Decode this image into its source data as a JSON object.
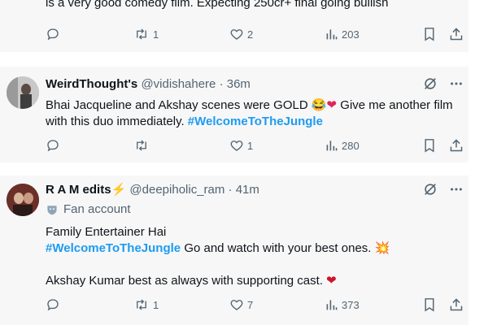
{
  "tweets": [
    {
      "text": "is a very good comedy film. Expecting 250cr+ final going bullish",
      "stats": {
        "replies": "",
        "retweets": "1",
        "likes": "2",
        "views": "203"
      }
    },
    {
      "name": "WeirdThought's",
      "handle": "@vidishahere",
      "dot": "·",
      "time": "36m",
      "text_part1": "Bhai Jacqueline and Akshay scenes were GOLD ",
      "emoji": "😂❤",
      "text_part2": " Give me another film with this duo immediately. ",
      "hashtag": "#WelcomeToTheJungle",
      "stats": {
        "replies": "",
        "retweets": "",
        "likes": "1",
        "views": "280"
      }
    },
    {
      "name": "R A M edits",
      "badge_emoji": "⚡",
      "handle": "@deepiholic_ram",
      "dot": "·",
      "time": "41m",
      "fan_label": "Fan account",
      "line1": "Family Entertainer Hai",
      "hashtag": "#WelcomeToTheJungle",
      "line2_rest": " Go and watch with your best ones. ",
      "line2_emoji": "💥",
      "line3": "Akshay Kumar best as always with supporting cast. ",
      "line3_emoji": "❤",
      "stats": {
        "replies": "",
        "retweets": "1",
        "likes": "7",
        "views": "373"
      }
    }
  ],
  "colors": {
    "accent": "#1d9bf0",
    "muted": "#536471",
    "heart": "#e0245e"
  },
  "icons": [
    "reply-icon",
    "retweet-icon",
    "like-icon",
    "views-icon",
    "bookmark-icon",
    "share-icon",
    "grok-icon",
    "more-icon",
    "fan-account-icon"
  ]
}
